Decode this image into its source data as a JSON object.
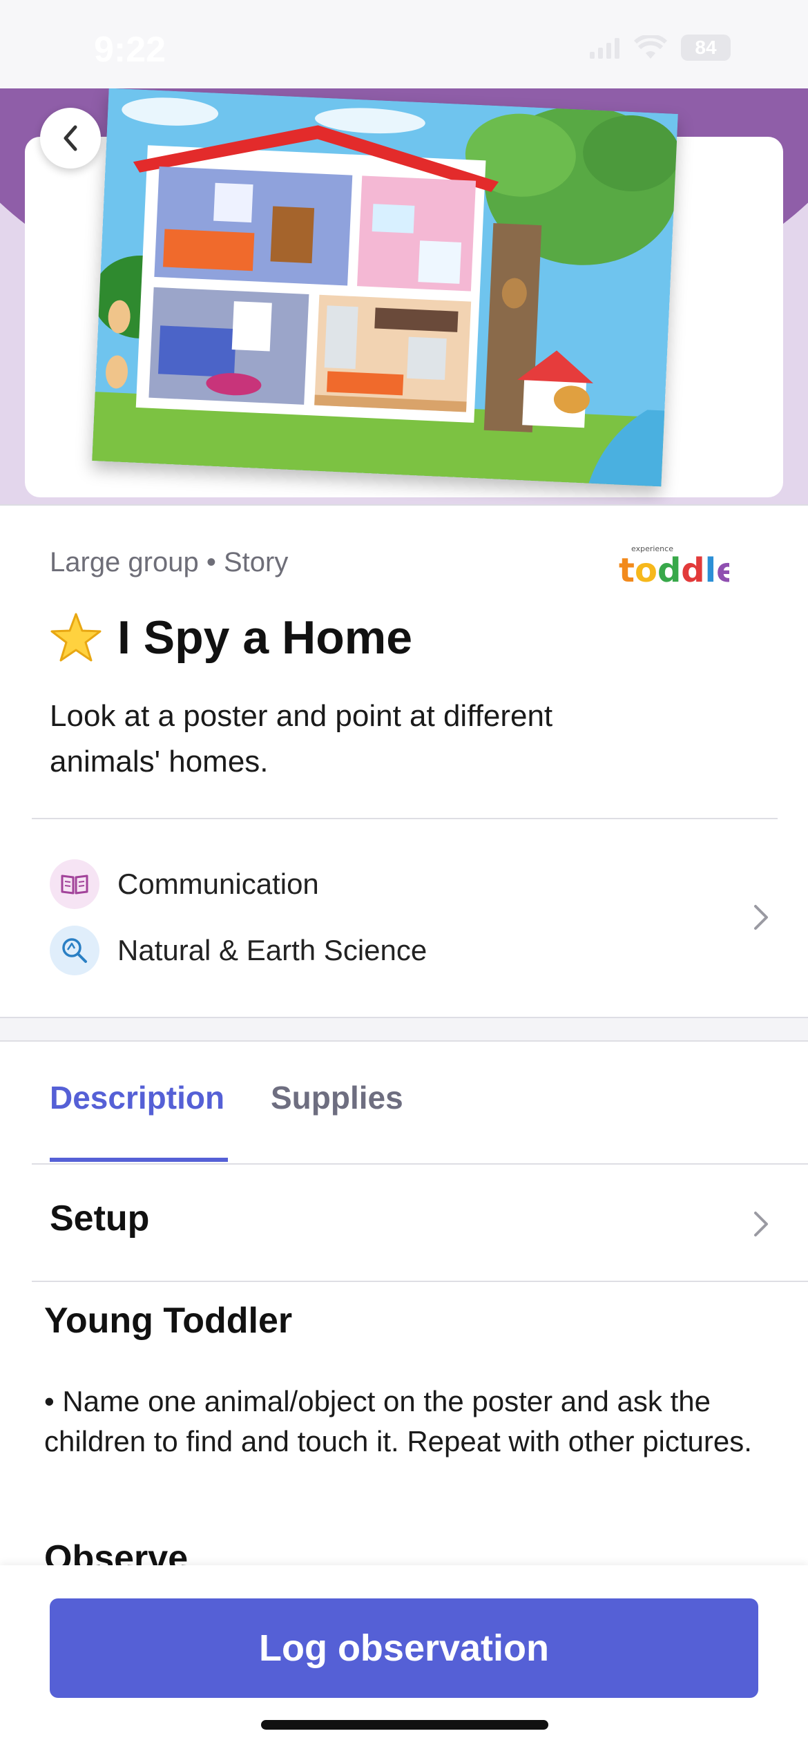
{
  "status_bar": {
    "time": "9:22",
    "battery": "84"
  },
  "activity": {
    "meta": "Large group • Story",
    "brand_small": "experience",
    "brand_name": "toddler",
    "title": "I Spy a Home",
    "summary": "Look at a poster and point at different animals' homes."
  },
  "domains": [
    {
      "label": "Communication",
      "icon": "book-icon"
    },
    {
      "label": "Natural & Earth Science",
      "icon": "magnifier-icon"
    }
  ],
  "tabs": [
    {
      "label": "Description",
      "active": true
    },
    {
      "label": "Supplies",
      "active": false
    }
  ],
  "setup": {
    "label": "Setup"
  },
  "content": {
    "age_heading": "Young Toddler",
    "instruction": "• Name one animal/object on the poster and ask the children to find and touch it. Repeat with other pictures.",
    "next_heading": "Observe"
  },
  "footer": {
    "button_label": "Log observation"
  },
  "colors": {
    "accent": "#5560d6",
    "hero_purple": "#8f5ea8"
  }
}
